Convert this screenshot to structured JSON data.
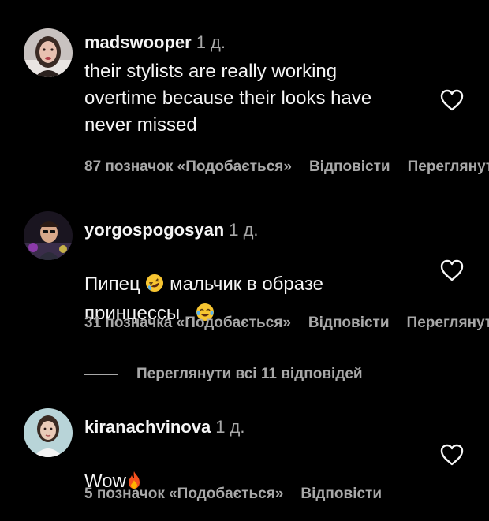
{
  "comments": [
    {
      "username": "madswooper",
      "time": "1 д.",
      "text": "their stylists are really working\novertime because their looks have\nnever missed",
      "likes": "87 позначок «Подобається»",
      "reply": "Відповісти",
      "translate": "Переглянути переклад"
    },
    {
      "username": "yorgospogosyan",
      "time": "1 д.",
      "text_part1": "Пипец ",
      "text_part2": " мальчик в образе",
      "text_part3": "принцессы . ",
      "emoji1": "rolling-on-floor-laughing-emoji",
      "emoji2": "tears-of-joy-emoji",
      "likes": "31 позначка «Подобається»",
      "reply": "Відповісти",
      "translate": "Переглянути переклад"
    },
    {
      "username": "kiranachvinova",
      "time": "1 д.",
      "text": "Wow",
      "emoji": "fire-emoji",
      "likes": "5 позначок «Подобається»",
      "reply": "Відповісти"
    }
  ],
  "view_replies": "Переглянути всі 11 відповідей",
  "icons": {
    "like": "heart-outline-icon"
  },
  "colors": {
    "background": "#000000",
    "primary_text": "#f5f5f5",
    "secondary_text": "#a8a8a8"
  }
}
